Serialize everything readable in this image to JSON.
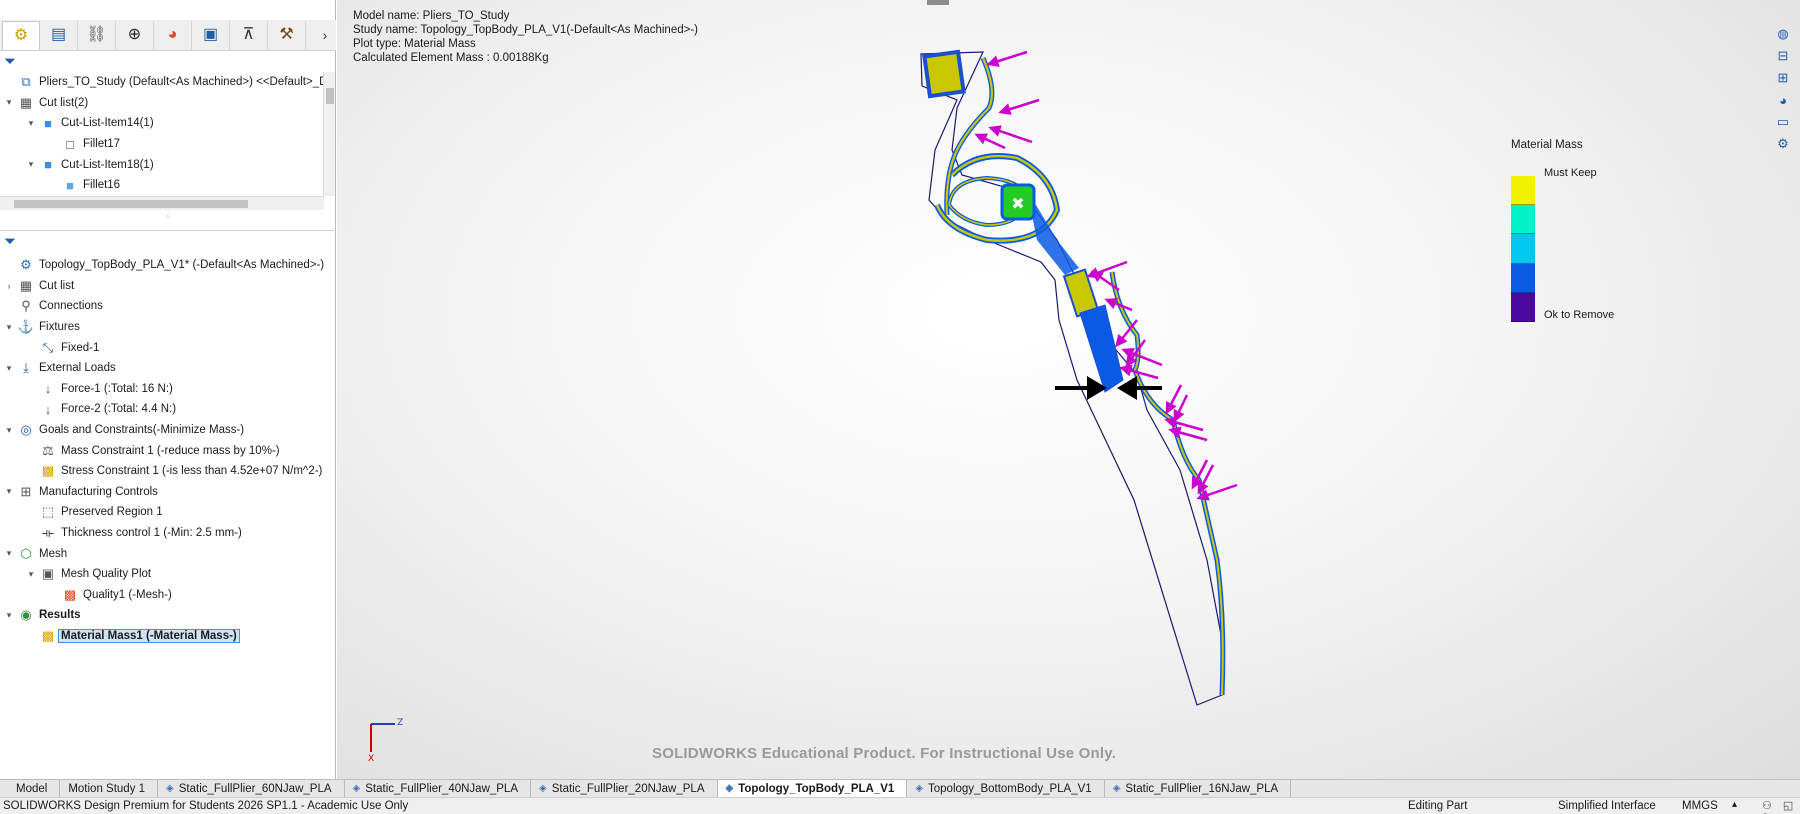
{
  "left_panel": {
    "manager_tabs": [
      {
        "icon": "feature-manager-icon",
        "glyph": "⚙",
        "color": "#d19a00"
      },
      {
        "icon": "property-manager-icon",
        "glyph": "▤",
        "color": "#1f5fa8"
      },
      {
        "icon": "configuration-manager-icon",
        "glyph": "⛓",
        "color": "#555555"
      },
      {
        "icon": "dimxpert-manager-icon",
        "glyph": "⊕",
        "color": "#222222"
      },
      {
        "icon": "display-manager-icon",
        "glyph": "◕",
        "color": "#d94e1f"
      },
      {
        "icon": "simulation-study-icon",
        "glyph": "▣",
        "color": "#1f5fa8"
      },
      {
        "icon": "cam-manager-icon",
        "glyph": "⊼",
        "color": "#333333"
      },
      {
        "icon": "toolbox-icon",
        "glyph": "⚒",
        "color": "#6d4c1f"
      }
    ],
    "cutlist_tree": [
      {
        "level": 0,
        "twist": "",
        "icon": "part-icon",
        "glyph": "⧉",
        "color": "#2f6fc0",
        "label": "Pliers_TO_Study (Default<As Machined>) <<Default>_D"
      },
      {
        "level": 0,
        "twist": "▾",
        "icon": "cut-list-icon",
        "glyph": "▦",
        "color": "#555555",
        "label": "Cut list(2)"
      },
      {
        "level": 1,
        "twist": "▾",
        "icon": "folder-icon",
        "glyph": "■",
        "color": "#3b8fd9",
        "label": "Cut-List-Item14(1)"
      },
      {
        "level": 2,
        "twist": "",
        "icon": "surface-body-icon",
        "glyph": "□",
        "color": "#444444",
        "label": "Fillet17"
      },
      {
        "level": 1,
        "twist": "▾",
        "icon": "folder-icon",
        "glyph": "■",
        "color": "#3b8fd9",
        "label": "Cut-List-Item18(1)"
      },
      {
        "level": 2,
        "twist": "",
        "icon": "solid-body-icon",
        "glyph": "■",
        "color": "#5fa8e8",
        "label": "Fillet16"
      }
    ],
    "study_tree": [
      {
        "level": 0,
        "twist": "",
        "icon": "study-icon",
        "glyph": "⚙",
        "color": "#2f6fc0",
        "label": "Topology_TopBody_PLA_V1* (-Default<As Machined>-)",
        "style": ""
      },
      {
        "level": 0,
        "twist": "›",
        "icon": "cut-list-icon",
        "glyph": "▦",
        "color": "#555555",
        "label": "Cut list",
        "style": ""
      },
      {
        "level": 0,
        "twist": "",
        "icon": "connections-icon",
        "glyph": "⚲",
        "color": "#555555",
        "label": "Connections",
        "style": ""
      },
      {
        "level": 0,
        "twist": "▾",
        "icon": "fixtures-icon",
        "glyph": "⚓",
        "color": "#555555",
        "label": "Fixtures",
        "style": ""
      },
      {
        "level": 1,
        "twist": "",
        "icon": "fixed-geometry-icon",
        "glyph": "⤡",
        "color": "#1f5fa8",
        "label": "Fixed-1",
        "style": ""
      },
      {
        "level": 0,
        "twist": "▾",
        "icon": "external-loads-icon",
        "glyph": "⤓",
        "color": "#1f5fa8",
        "label": "External Loads",
        "style": ""
      },
      {
        "level": 1,
        "twist": "",
        "icon": "force-icon",
        "glyph": "↓",
        "color": "#1f5fa8",
        "label": "Force-1 (:Total: 16 N:)",
        "style": ""
      },
      {
        "level": 1,
        "twist": "",
        "icon": "force-icon",
        "glyph": "↓",
        "color": "#1f5fa8",
        "label": "Force-2 (:Total: 4.4 N:)",
        "style": ""
      },
      {
        "level": 0,
        "twist": "▾",
        "icon": "goals-constraints-icon",
        "glyph": "◎",
        "color": "#1f5fa8",
        "label": "Goals and Constraints(-Minimize Mass-)",
        "style": ""
      },
      {
        "level": 1,
        "twist": "",
        "icon": "mass-constraint-icon",
        "glyph": "⚖",
        "color": "#555555",
        "label": "Mass Constraint 1 (-reduce mass by 10%-)",
        "style": ""
      },
      {
        "level": 1,
        "twist": "",
        "icon": "stress-constraint-icon",
        "glyph": "▩",
        "color": "#d9a400",
        "label": "Stress Constraint 1 (-is less than 4.52e+07 N/m^2-)",
        "style": ""
      },
      {
        "level": 0,
        "twist": "▾",
        "icon": "manufacturing-controls-icon",
        "glyph": "⊞",
        "color": "#555555",
        "label": "Manufacturing Controls",
        "style": ""
      },
      {
        "level": 1,
        "twist": "",
        "icon": "preserved-region-icon",
        "glyph": "⬚",
        "color": "#555555",
        "label": "Preserved Region 1",
        "style": ""
      },
      {
        "level": 1,
        "twist": "",
        "icon": "thickness-control-icon",
        "glyph": "⟛",
        "color": "#333333",
        "label": "Thickness control 1 (-Min:  2.5 mm-)",
        "style": ""
      },
      {
        "level": 0,
        "twist": "▾",
        "icon": "mesh-icon",
        "glyph": "⬡",
        "color": "#2f8f3f",
        "label": "Mesh",
        "style": ""
      },
      {
        "level": 1,
        "twist": "▾",
        "icon": "mesh-quality-plot-icon",
        "glyph": "▣",
        "color": "#555555",
        "label": "Mesh Quality Plot",
        "style": ""
      },
      {
        "level": 2,
        "twist": "",
        "icon": "quality-plot-icon",
        "glyph": "▩",
        "color": "#d94e1f",
        "label": "Quality1 (-Mesh-)",
        "style": ""
      },
      {
        "level": 0,
        "twist": "▾",
        "icon": "results-icon",
        "glyph": "◉",
        "color": "#2f8f3f",
        "label": "Results",
        "style": "bold"
      },
      {
        "level": 1,
        "twist": "",
        "icon": "material-mass-plot-icon",
        "glyph": "▩",
        "color": "#d9a400",
        "label": "Material Mass1 (-Material Mass-)",
        "style": "selected"
      }
    ]
  },
  "graphics": {
    "info": {
      "model_name": "Model name: Pliers_TO_Study",
      "study_name": "Study name: Topology_TopBody_PLA_V1(-Default<As Machined>-)",
      "plot_type": "Plot type: Material Mass",
      "element_mass": "Calculated Element Mass :  0.00188Kg"
    },
    "legend": {
      "title": "Material Mass",
      "max_label": "Must Keep",
      "min_label": "Ok to Remove",
      "colors": [
        "#f2f200",
        "#00f2c8",
        "#00c8f0",
        "#0a5ae6",
        "#4a0aa0"
      ]
    },
    "heads_up_tools": [
      "view-orientation-icon",
      "display-style-icon",
      "hide-show-icon",
      "appearance-icon",
      "scene-icon",
      "view-settings-icon"
    ],
    "triad": {
      "z_label": "Z",
      "x_label": "X"
    },
    "watermark": "SOLIDWORKS Educational Product. For Instructional Use Only.",
    "colors": {
      "load_arrow": "#cc00cc",
      "fixture_arrow": "#000000",
      "keep": "#c8c800",
      "remove": "#0a5ae6",
      "preserved": "#22cc22"
    }
  },
  "document_tabs": [
    {
      "label": "Model",
      "active": false,
      "glyph": ""
    },
    {
      "label": "Motion Study 1",
      "active": false,
      "glyph": ""
    },
    {
      "label": "Static_FullPlier_60NJaw_PLA",
      "active": false,
      "glyph": "◈"
    },
    {
      "label": "Static_FullPlier_40NJaw_PLA",
      "active": false,
      "glyph": "◈"
    },
    {
      "label": "Static_FullPlier_20NJaw_PLA",
      "active": false,
      "glyph": "◈"
    },
    {
      "label": "Topology_TopBody_PLA_V1",
      "active": true,
      "glyph": "◈"
    },
    {
      "label": "Topology_BottomBody_PLA_V1",
      "active": false,
      "glyph": "◈"
    },
    {
      "label": "Static_FullPlier_16NJaw_PLA",
      "active": false,
      "glyph": "◈"
    }
  ],
  "status_bar": {
    "product": "SOLIDWORKS Design Premium for Students 2026 SP1.1 - Academic Use Only",
    "mode": "Editing Part",
    "interface": "Simplified Interface",
    "units": "MMGS",
    "units_arrow": "▴",
    "tool_icons": "⚇ ◱ ?"
  }
}
